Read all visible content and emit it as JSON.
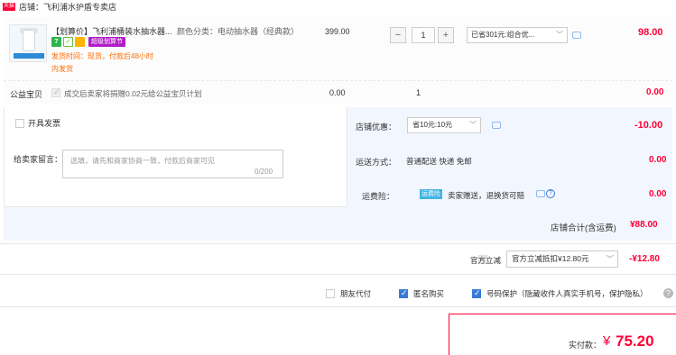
{
  "shop": {
    "badge": "天猫",
    "label": "店铺：飞利浦水护盾专卖店"
  },
  "item": {
    "title": "【划算价】飞利浦桶装水抽水器...",
    "spec": "颜色分类：电动抽水器（经典款）",
    "icons": [
      "seven-day-return-icon",
      "guarantee-icon",
      "card-icon"
    ],
    "icon_seven": "7",
    "icon_check": "✓",
    "promo_tag": "超级划算节",
    "ship_line1": "发货时间：现货，付款后48小时",
    "ship_line2": "内发货",
    "price": "399.00",
    "quantity": "1",
    "minus": "−",
    "plus": "+",
    "discount_select": "已省301元:组合优...",
    "subtotal": "98.00"
  },
  "charity": {
    "label": "公益宝贝",
    "text": "成交后卖家将捐赠0.02元给公益宝贝计划",
    "price": "0.00",
    "qty": "1",
    "subtotal": "0.00"
  },
  "options": {
    "invoice_label": "开具发票",
    "message_label": "给卖家留言：",
    "message_placeholder": "选填，请先和商家协商一致，付款后商家可见",
    "message_count": "0/200",
    "coupon_label": "店铺优惠：",
    "coupon_select": "省10元:10元",
    "coupon_value": "-10.00",
    "shipping_label": "运送方式：",
    "shipping_value": "普通配送 快递 免邮",
    "shipping_sub": "0.00",
    "insurance_label": "运费险：",
    "insurance_tag": "运费险",
    "insurance_text": "卖家赠送，退换货可赔",
    "insurance_sub": "0.00",
    "total_label": "店铺合计(含运费)",
    "total_value": "¥88.00"
  },
  "official": {
    "label": "官方立减",
    "select": "官方立减抵扣¥12.80元",
    "value": "-¥12.80"
  },
  "bottom_options": {
    "friend_pay": "朋友代付",
    "anonymous": "匿名购买",
    "number_protect": "号码保护（隐藏收件人真实手机号，保护隐私）",
    "help": "?"
  },
  "payment": {
    "label": "实付款：",
    "yen": "¥",
    "value": "75.20"
  },
  "colors": {
    "accent": "#ff0036",
    "blue": "#3a7bd5",
    "bg_blue": "#f2f7ff"
  }
}
